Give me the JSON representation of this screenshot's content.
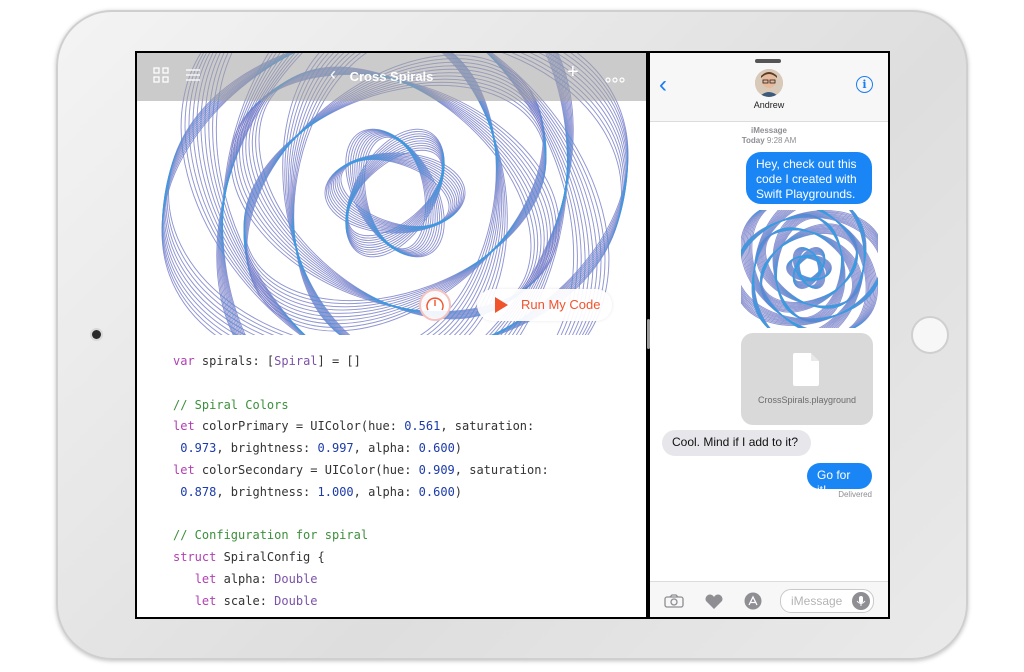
{
  "playground": {
    "title": "Cross Spirals",
    "run_label": "Run My Code",
    "icons": {
      "toolbar_left_1": "grid-icon",
      "toolbar_left_2": "list-icon",
      "back": "chevron-left-icon",
      "add": "plus-icon",
      "more": "more-icon",
      "speed": "speedometer-icon",
      "run": "play-icon"
    },
    "colors": {
      "accent": "#f0542d",
      "pink": "#f1338f",
      "blue": "#2fa3e6"
    },
    "code": [
      [
        {
          "t": "var",
          "c": "kw"
        },
        {
          "t": " spirals: ["
        },
        {
          "t": "Spiral",
          "c": "ty"
        },
        {
          "t": "] = []"
        }
      ],
      [],
      [
        {
          "t": "// Spiral Colors",
          "c": "cm"
        }
      ],
      [
        {
          "t": "let",
          "c": "kw"
        },
        {
          "t": " colorPrimary = UIColor(hue: "
        },
        {
          "t": "0.561",
          "c": "num"
        },
        {
          "t": ", saturation:"
        }
      ],
      [
        {
          "t": " "
        },
        {
          "t": "0.973",
          "c": "num"
        },
        {
          "t": ", brightness: "
        },
        {
          "t": "0.997",
          "c": "num"
        },
        {
          "t": ", alpha: "
        },
        {
          "t": "0.600",
          "c": "num"
        },
        {
          "t": ")"
        }
      ],
      [
        {
          "t": "let",
          "c": "kw"
        },
        {
          "t": " colorSecondary = UIColor(hue: "
        },
        {
          "t": "0.909",
          "c": "num"
        },
        {
          "t": ", saturation:"
        }
      ],
      [
        {
          "t": " "
        },
        {
          "t": "0.878",
          "c": "num"
        },
        {
          "t": ", brightness: "
        },
        {
          "t": "1.000",
          "c": "num"
        },
        {
          "t": ", alpha: "
        },
        {
          "t": "0.600",
          "c": "num"
        },
        {
          "t": ")"
        }
      ],
      [],
      [
        {
          "t": "// Configuration for spiral",
          "c": "cm"
        }
      ],
      [
        {
          "t": "struct",
          "c": "kw"
        },
        {
          "t": " SpiralConfig {"
        }
      ],
      [
        {
          "t": "   "
        },
        {
          "t": "let",
          "c": "kw"
        },
        {
          "t": " alpha: "
        },
        {
          "t": "Double",
          "c": "ty"
        }
      ],
      [
        {
          "t": "   "
        },
        {
          "t": "let",
          "c": "kw"
        },
        {
          "t": " scale: "
        },
        {
          "t": "Double",
          "c": "ty"
        }
      ]
    ]
  },
  "messages": {
    "contact": "Andrew",
    "service": "iMessage",
    "timestamp_day": "Today",
    "timestamp_time": "9:28 AM",
    "bubbles": [
      {
        "text_lines": [
          "Hey, check out this",
          "code I created with",
          "Swift Playgrounds."
        ],
        "dir": "out"
      },
      {
        "text_lines": [
          "Cool. Mind if I add to it?"
        ],
        "dir": "in"
      },
      {
        "text_lines": [
          "Go for it!"
        ],
        "dir": "out"
      }
    ],
    "attachment_name": "CrossSpirals.playground",
    "delivered": "Delivered",
    "input_placeholder": "iMessage",
    "icons": {
      "back": "chevron-left-icon",
      "info": "info-icon",
      "camera": "camera-icon",
      "digital_touch": "heart-icon",
      "apps": "app-store-icon",
      "mic": "microphone-icon"
    },
    "colors": {
      "bubble_out": "#1a86f5",
      "bubble_in": "#e6e6eb",
      "tint": "#1a7cf5"
    }
  }
}
